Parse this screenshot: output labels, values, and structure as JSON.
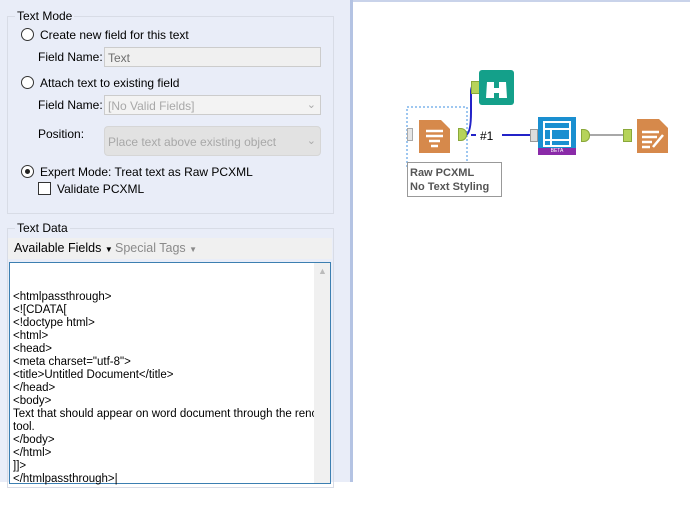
{
  "text_mode": {
    "title": "Text Mode",
    "create_label": "Create new field for this text",
    "create_field_label": "Field Name:",
    "create_field_value": "Text",
    "attach_label": "Attach text to existing field",
    "attach_field_label": "Field Name:",
    "attach_field_value": "[No Valid Fields]",
    "position_label": "Position:",
    "position_value": "Place text above existing object",
    "expert_label": "Expert Mode: Treat text as Raw PCXML",
    "validate_label": "Validate PCXML",
    "selected": "expert"
  },
  "text_data": {
    "title": "Text Data",
    "available_fields": "Available Fields",
    "special_tags": "Special Tags",
    "content": "<htmlpassthrough>\n<![CDATA[\n<!doctype html>\n<html>\n<head>\n<meta charset=\"utf-8\">\n<title>Untitled Document</title>\n</head>\n<body>\nText that should appear on word document through the rencer\ntool.\n</body>\n</html>\n]]>\n</htmlpassthrough>|"
  },
  "canvas": {
    "connection_label": "#1",
    "annotation_line1": "Raw PCXML",
    "annotation_line2": "No Text Styling",
    "beta_badge": "BETA"
  }
}
